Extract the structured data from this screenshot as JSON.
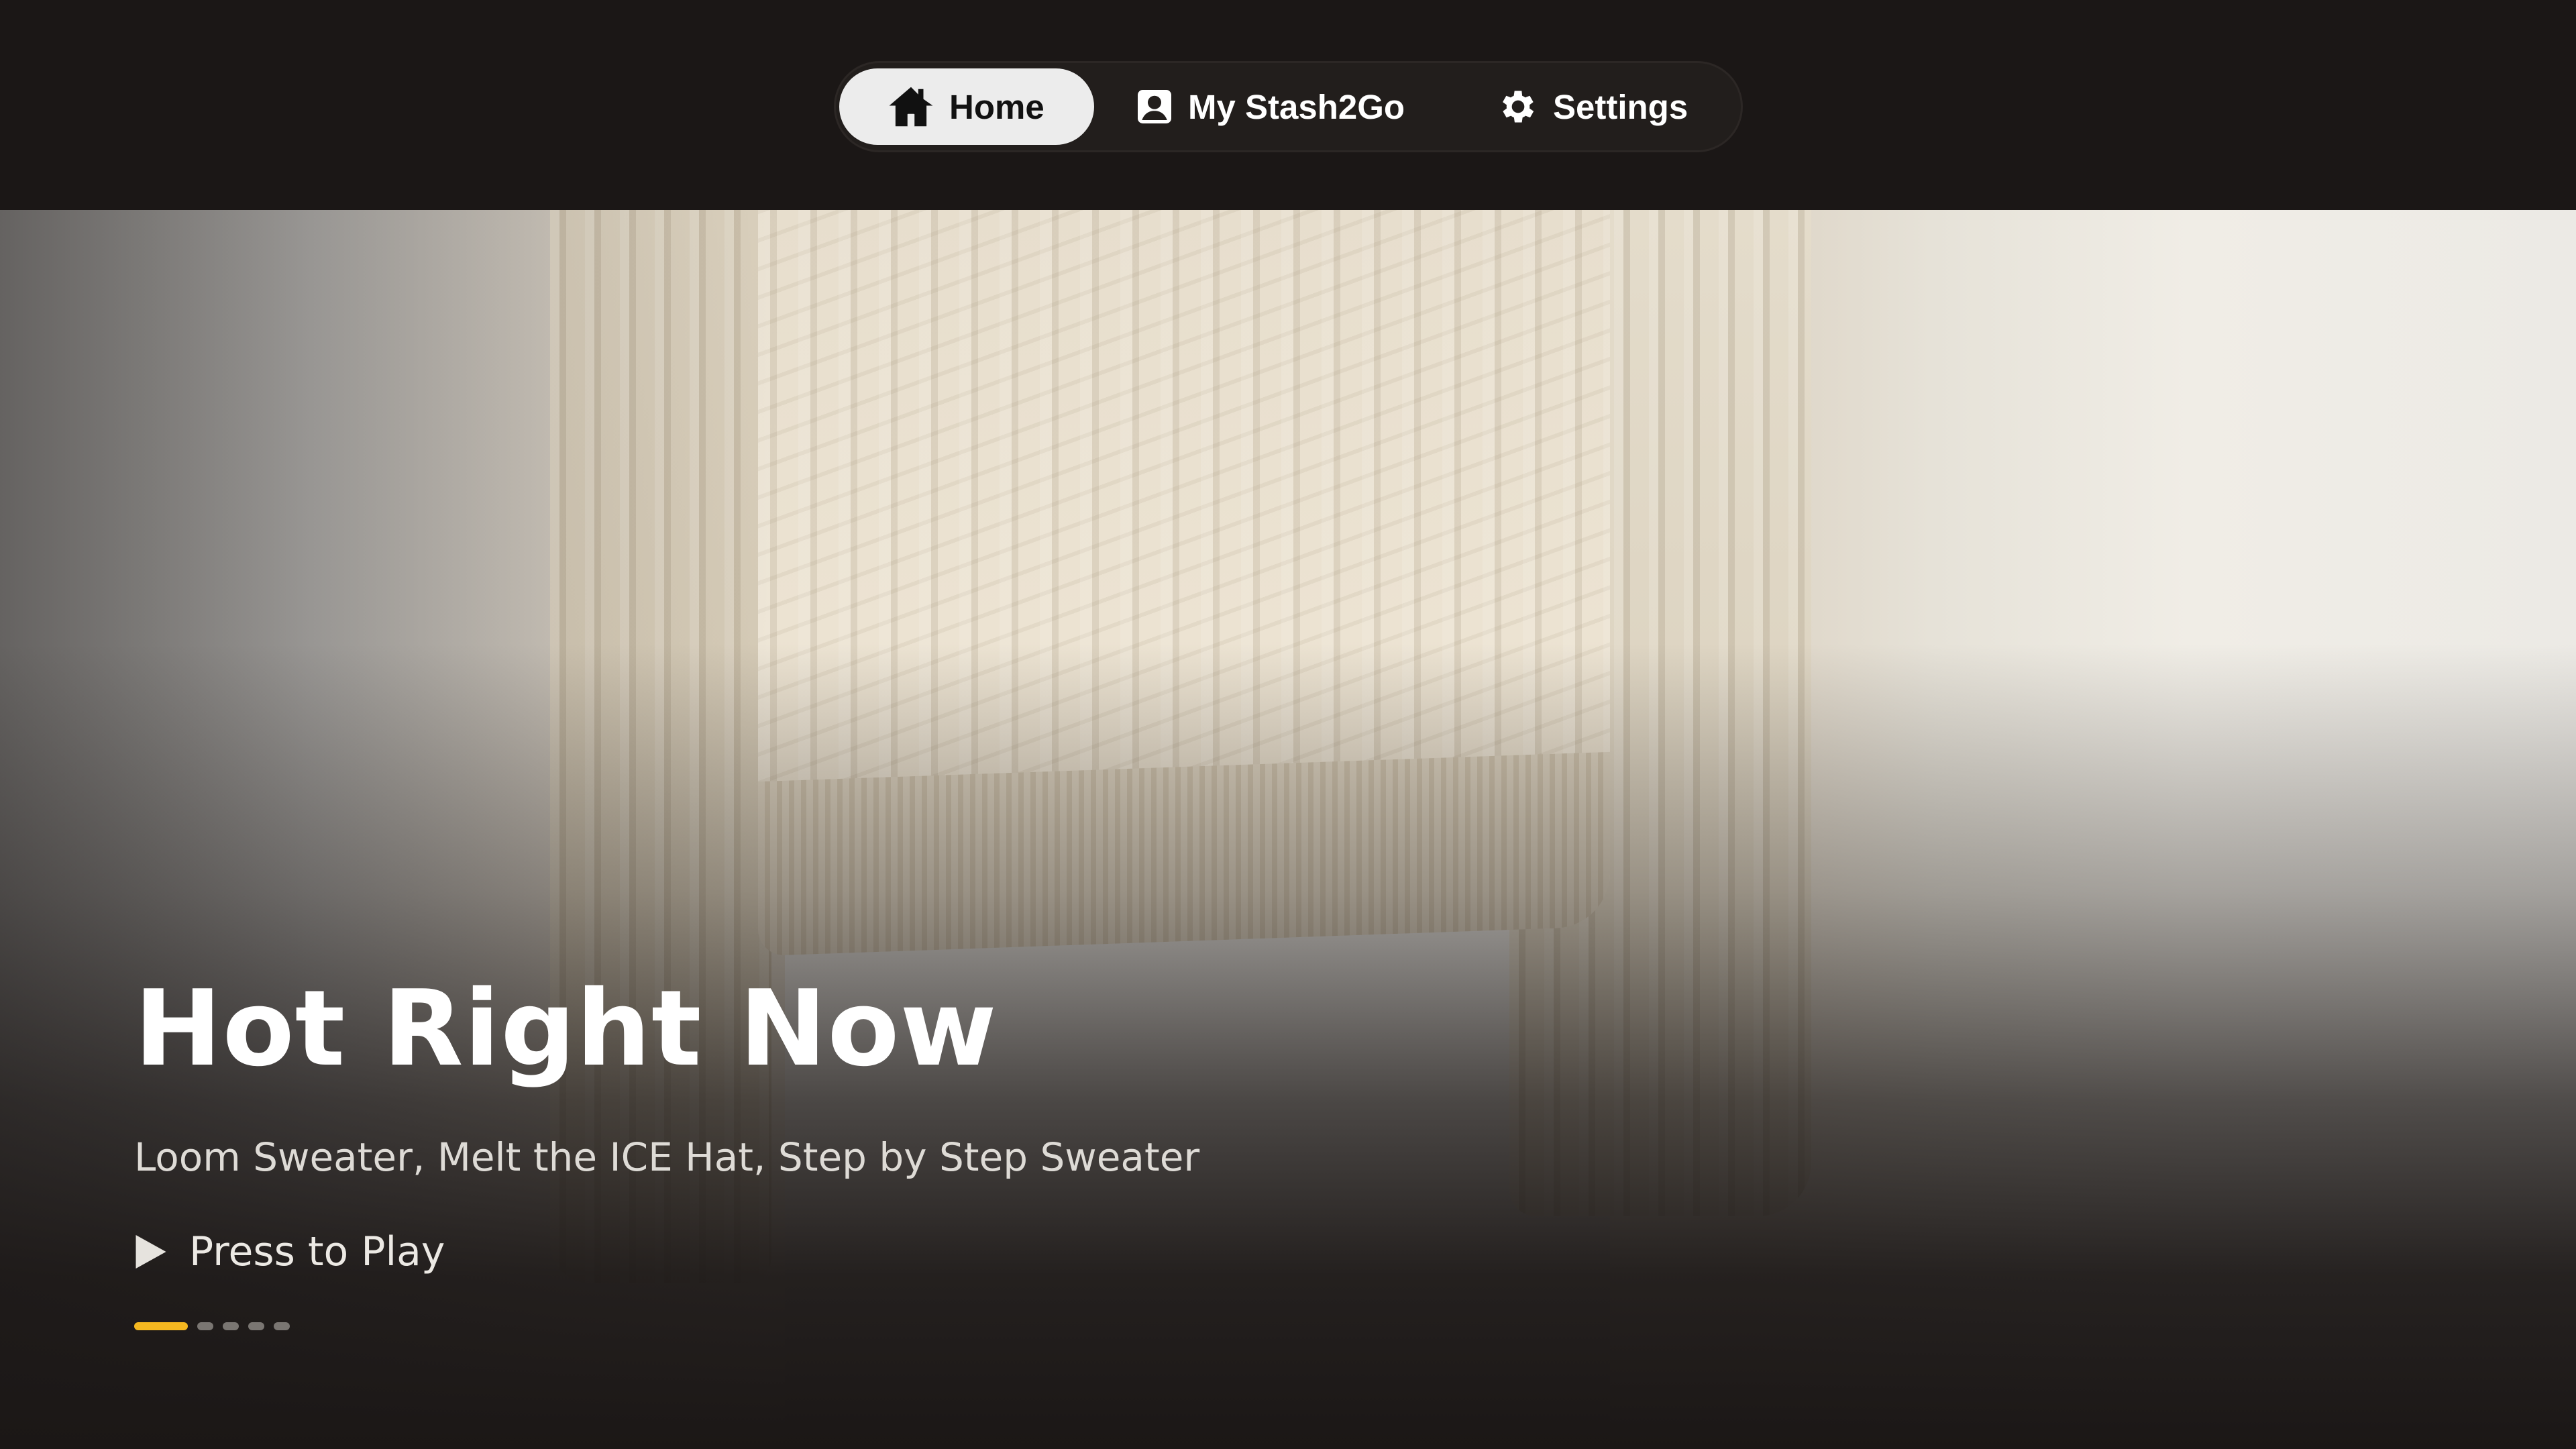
{
  "nav": {
    "items": [
      {
        "label": "Home",
        "icon": "home-icon",
        "active": true
      },
      {
        "label": "My Stash2Go",
        "icon": "profile-icon",
        "active": false
      },
      {
        "label": "Settings",
        "icon": "gear-icon",
        "active": false
      }
    ]
  },
  "hero": {
    "title": "Hot Right Now",
    "subtitle": "Loom Sweater, Melt the ICE Hat, Step by Step Sweater",
    "play_label": "Press to Play",
    "slides_total": 5,
    "active_slide": 1
  },
  "colors": {
    "accent": "#f5b820",
    "background": "#1b1716",
    "nav_active_bg": "#ececec"
  }
}
